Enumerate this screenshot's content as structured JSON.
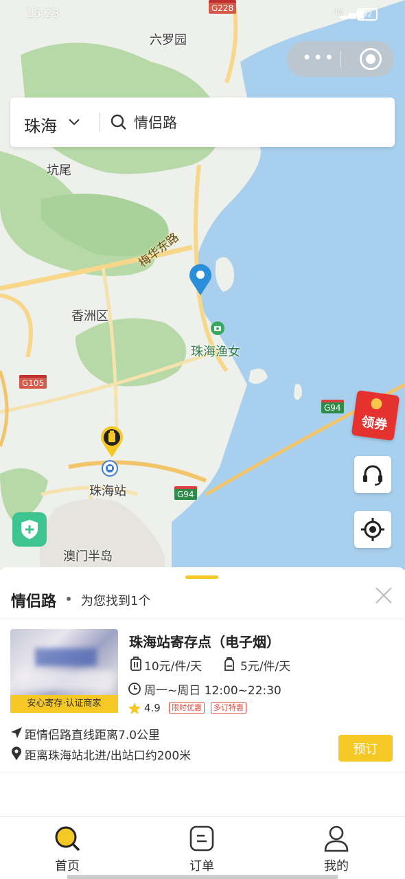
{
  "status_bar": {
    "time": "15:23",
    "network": "4G",
    "battery": "92"
  },
  "map": {
    "labels": {
      "liuluoyuan": "六罗园",
      "kengwei": "坑尾",
      "road_meihua": "梅华东路",
      "xiangzhou": "香洲区",
      "zhuhai_yunv": "珠海渔女",
      "zhuhai_station": "珠海站",
      "macau": "澳门半岛"
    },
    "shields": {
      "g228": "G228",
      "g105": "G105",
      "g94_a": "G94",
      "g94_b": "G94"
    },
    "coupon_label": "领券"
  },
  "search": {
    "city": "珠海",
    "value": "情侣路",
    "placeholder": ""
  },
  "sheet": {
    "title": "情侣路",
    "found_text": "为您找到1个",
    "store": {
      "name": "珠海站寄存点（电子烟）",
      "tag": "安心寄存·认证商家",
      "price_luggage": "10元/件/天",
      "price_bag": "5元/件/天",
      "hours": "周一~周日 12:00~22:30",
      "rating": "4.9",
      "promo1": "限时优惠",
      "promo2": "多订特惠",
      "distance": "距情侣路直线距离7.0公里",
      "location": "距离珠海站北进/出站口约200米",
      "book_label": "预订"
    }
  },
  "tabbar": {
    "home": "首页",
    "orders": "订单",
    "mine": "我的"
  },
  "colors": {
    "accent": "#f5c825",
    "map_water": "#a8d0ee",
    "map_green": "#b6d9a7",
    "promo_red": "#e04a3a"
  }
}
